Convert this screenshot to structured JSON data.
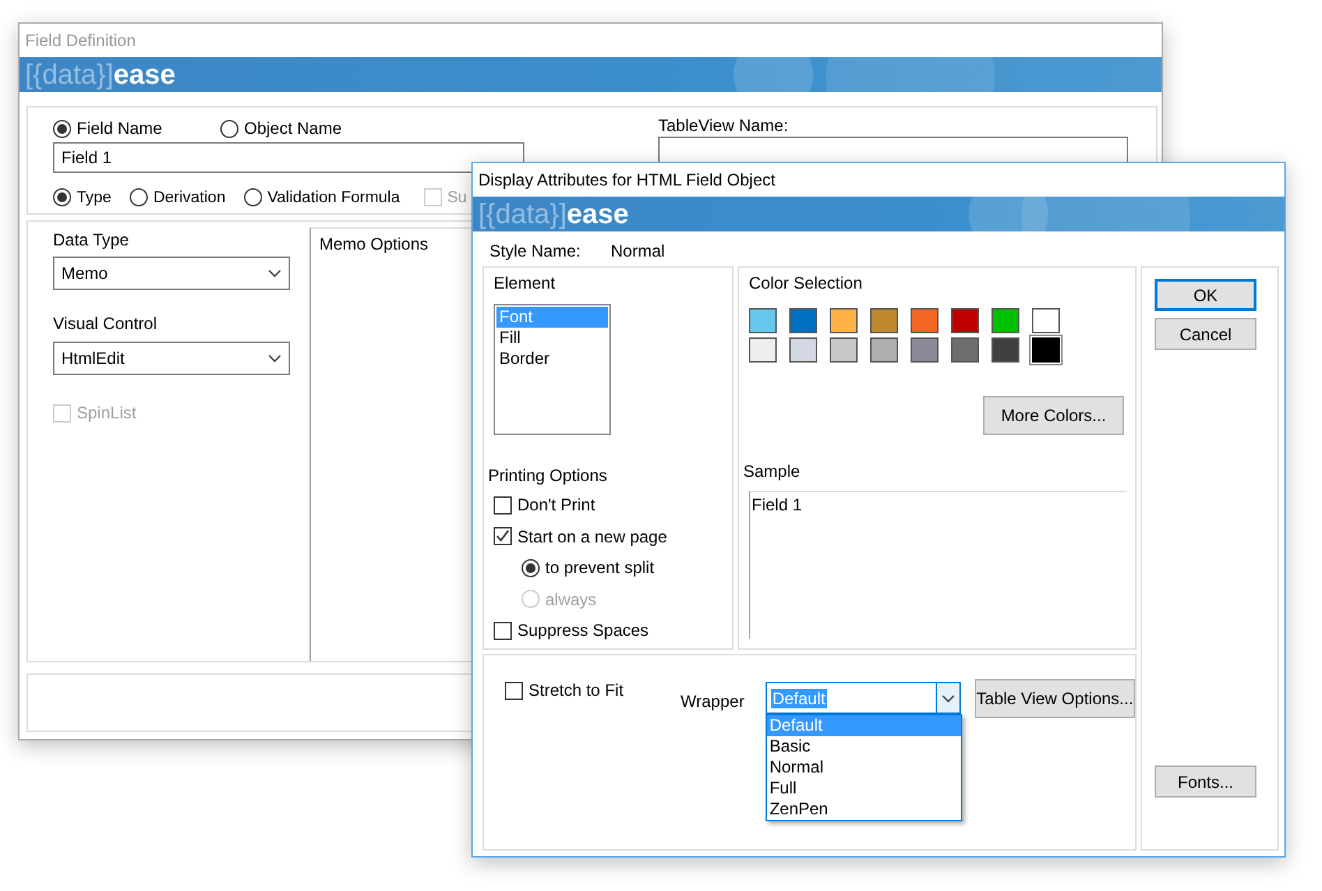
{
  "background_window": {
    "title": "Field Definition",
    "banner": {
      "logo_prefix": "[{data}]",
      "logo_suffix": "ease"
    },
    "name_choice": [
      {
        "label": "Field Name",
        "selected": true
      },
      {
        "label": "Object Name",
        "selected": false
      }
    ],
    "field_name": {
      "value": "Field 1"
    },
    "tableview_name": {
      "label": "TableView Name:"
    },
    "mode_choice": [
      {
        "label": "Type",
        "selected": true
      },
      {
        "label": "Derivation",
        "selected": false
      },
      {
        "label": "Validation Formula",
        "selected": false
      }
    ],
    "partial_checkbox": {
      "label": "Su",
      "checked": false,
      "disabled": true
    },
    "data_type": {
      "label": "Data Type",
      "value": "Memo"
    },
    "visual_control": {
      "label": "Visual Control",
      "value": "HtmlEdit"
    },
    "spinlist": {
      "label": "SpinList",
      "checked": false,
      "disabled": true
    },
    "memo_options": {
      "label": "Memo Options"
    }
  },
  "dialog": {
    "title": "Display Attributes for HTML Field Object",
    "banner": {
      "logo_prefix": "[{data}]",
      "logo_suffix": "ease"
    },
    "style_name": {
      "label": "Style Name:",
      "value": "Normal"
    },
    "element": {
      "label": "Element",
      "items": [
        {
          "label": "Font",
          "selected": true
        },
        {
          "label": "Fill",
          "selected": false
        },
        {
          "label": "Border",
          "selected": false
        }
      ]
    },
    "printing_options": {
      "label": "Printing Options",
      "items": [
        {
          "kind": "checkbox",
          "label": "Don't Print",
          "checked": false,
          "disabled": false
        },
        {
          "kind": "checkbox",
          "label": "Start on a new page",
          "checked": true,
          "disabled": false
        },
        {
          "kind": "radio",
          "label": "to prevent split",
          "selected": true,
          "disabled": false
        },
        {
          "kind": "radio",
          "label": "always",
          "selected": false,
          "disabled": true
        },
        {
          "kind": "checkbox",
          "label": "Suppress Spaces",
          "checked": false,
          "disabled": false
        }
      ]
    },
    "color_selection": {
      "label": "Color Selection",
      "swatches": [
        {
          "color": "#66c8ec",
          "selected": false
        },
        {
          "color": "#0070c0",
          "selected": false
        },
        {
          "color": "#ffb347",
          "selected": false
        },
        {
          "color": "#c0882e",
          "selected": false
        },
        {
          "color": "#f26522",
          "selected": false
        },
        {
          "color": "#c00000",
          "selected": false
        },
        {
          "color": "#00c000",
          "selected": false
        },
        {
          "color": "#ffffff",
          "selected": false
        },
        {
          "color": "#eeeeee",
          "selected": false
        },
        {
          "color": "#d4d8e2",
          "selected": false
        },
        {
          "color": "#c8c8c8",
          "selected": false
        },
        {
          "color": "#aeb0b0",
          "selected": false
        },
        {
          "color": "#8a8a9a",
          "selected": false
        },
        {
          "color": "#6e6e6e",
          "selected": false
        },
        {
          "color": "#404040",
          "selected": false
        },
        {
          "color": "#000000",
          "selected": true
        }
      ],
      "more_button": "More Colors..."
    },
    "sample": {
      "label": "Sample",
      "text": "Field 1"
    },
    "stretch_to_fit": {
      "label": "Stretch to Fit",
      "checked": false
    },
    "wrapper": {
      "label": "Wrapper",
      "value": "Default",
      "expanded": true,
      "options": [
        {
          "label": "Default",
          "selected": true
        },
        {
          "label": "Basic",
          "selected": false
        },
        {
          "label": "Normal",
          "selected": false
        },
        {
          "label": "Full",
          "selected": false
        },
        {
          "label": "ZenPen",
          "selected": false
        }
      ]
    },
    "table_view_button": "Table View Options...",
    "buttons": [
      {
        "label": "OK",
        "default": true
      },
      {
        "label": "Cancel",
        "default": false
      }
    ],
    "fonts_button": "Fonts..."
  }
}
